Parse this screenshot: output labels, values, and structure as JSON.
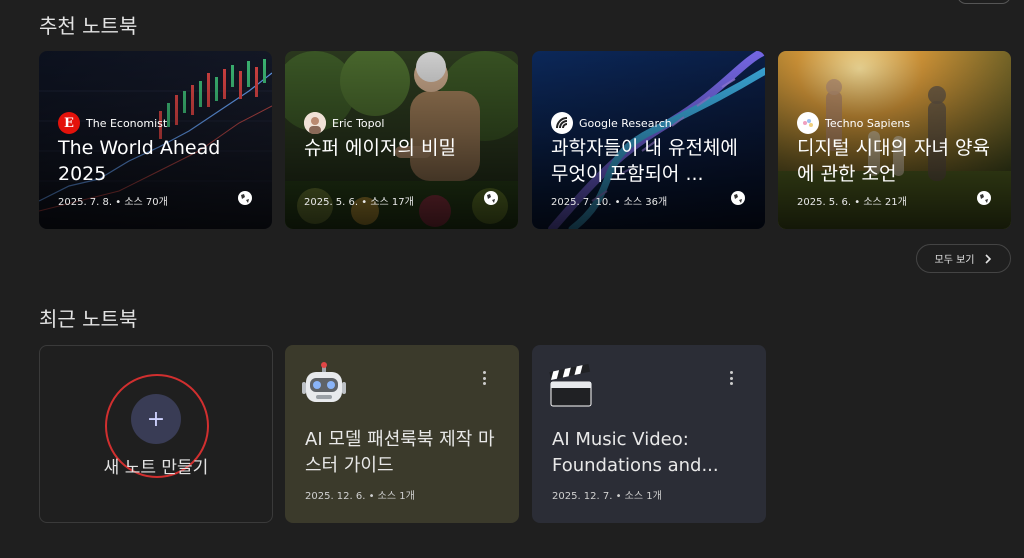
{
  "sections": {
    "featured_title": "추천 노트북",
    "recent_title": "최근 노트북"
  },
  "featured": [
    {
      "source": "The Economist",
      "title": "The World Ahead 2025",
      "meta": "2025. 7. 8. • 소스 70개",
      "logo_icon": "economist-logo-icon"
    },
    {
      "source": "Eric Topol",
      "title": "슈퍼 에이저의 비밀",
      "meta": "2025. 5. 6. • 소스 17개",
      "logo_icon": "avatar-icon"
    },
    {
      "source": "Google Research",
      "title": "과학자들이 내 유전체에 무엇이 포함되어 ...",
      "meta": "2025. 7. 10. • 소스 36개",
      "logo_icon": "google-research-logo-icon"
    },
    {
      "source": "Techno Sapiens",
      "title": "디지털 시대의 자녀 양육에 관한 조언",
      "meta": "2025. 5. 6. • 소스 21개",
      "logo_icon": "techno-sapiens-logo-icon"
    }
  ],
  "see_all_label": "모두 보기",
  "new_notebook_label": "새 노트 만들기",
  "recent": [
    {
      "title": "AI 모델 패션룩북 제작 마스터 가이드",
      "meta": "2025. 12. 6. • 소스 1개",
      "icon": "robot-icon"
    },
    {
      "title": "AI Music Video: Foundations and...",
      "meta": "2025. 12. 7. • 소스 1개",
      "icon": "clapperboard-icon"
    }
  ],
  "colors": {
    "background": "#1f1f1f",
    "accent_button": "#393c55",
    "highlight_ring": "#d12f2f"
  }
}
